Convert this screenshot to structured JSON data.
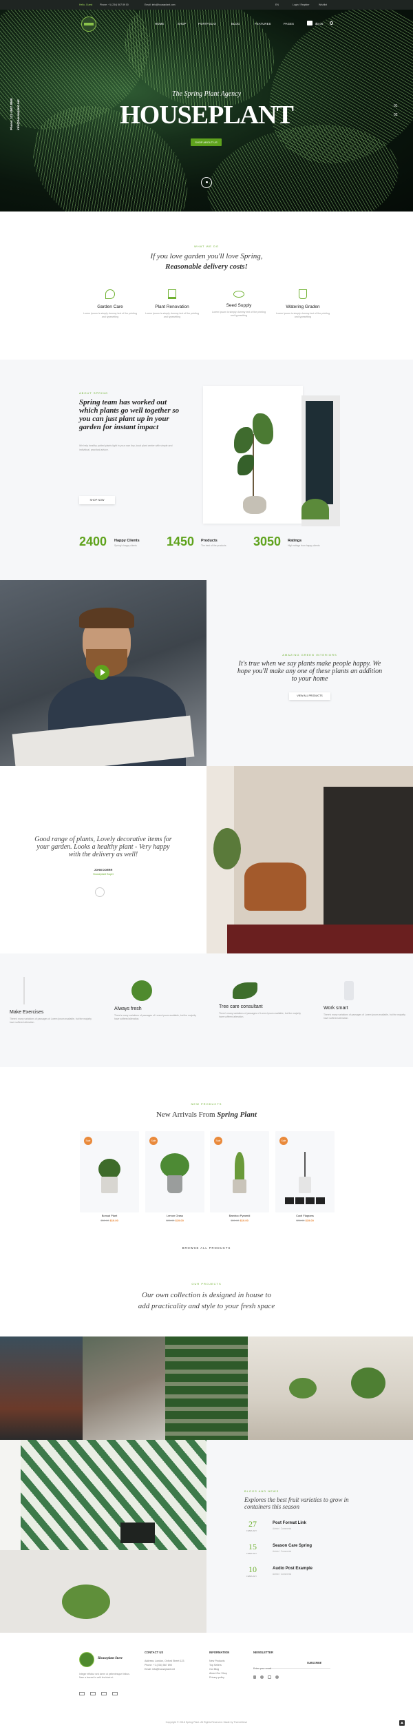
{
  "topbar": {
    "left": "Hello, Guest",
    "phone": "Phone: +1 (234) 567 89 00",
    "email": "Email: info@houseplant.com",
    "lang": "EN",
    "account": "Login / Register",
    "wishlist": "Wishlist"
  },
  "nav": {
    "items": [
      "HOME",
      "SHOP",
      "PORTFOLIO",
      "BLOG",
      "FEATURES",
      "PAGES"
    ],
    "cart": "$0.00"
  },
  "hero": {
    "subtitle": "The Spring Plant Agency",
    "title": "HOUSEPLANT",
    "button": "SHOP ABOUT US",
    "side_phone": "Phone: 123 4567 8900",
    "side_email": "info@houseplant.net",
    "slides": [
      "01",
      "02"
    ]
  },
  "intro": {
    "label": "WHAT WE DO",
    "line1": "If you love garden you'll love Spring,",
    "line2": "Reasonable delivery costs!",
    "features": [
      {
        "title": "Garden Care",
        "text": "Lorem Ipsum is simply dummy text of the printing and typesetting"
      },
      {
        "title": "Plant Renovation",
        "text": "Lorem Ipsum is simply dummy text of the printing and typesetting"
      },
      {
        "title": "Seed Supply",
        "text": "Lorem Ipsum is simply dummy text of the printing and typesetting"
      },
      {
        "title": "Watering Graden",
        "text": "Lorem Ipsum is simply dummy text of the printing and typesetting"
      }
    ]
  },
  "about": {
    "label": "ABOUT SPRING",
    "headline": "Spring team has worked out which plants go well together so you can just plant up in your garden for instant impact",
    "body": "We help healthy potted plants light in your own tiny, local plant center with simple and individual, practical advice.",
    "button": "SHOP NOW",
    "stats": [
      {
        "num": "2400",
        "label": "Happy Clients",
        "sub": "Spring's happy clients"
      },
      {
        "num": "1450",
        "label": "Products",
        "sub": "The best of the products"
      },
      {
        "num": "3050",
        "label": "Ratings",
        "sub": "High ratings from happy clients"
      }
    ]
  },
  "promo": {
    "label": "AMAZING GREEN INTERIORS",
    "text": "It's true when we say plants make people happy. We hope you'll make any one of these plants an addition to your home",
    "button": "VIEW ALL PRODUCTS"
  },
  "quote": {
    "text": "Good range of plants, Lovely decorative items for your garden. Looks a healthy plant - Very happy with the delivery as well!",
    "author": "JOHN DOERR",
    "role": "Houseplant Buyer"
  },
  "services": [
    {
      "title": "Make Exercises",
      "text": "There's many variations of passages of Lorem Ipsum available, but the majority have suffered alteration."
    },
    {
      "title": "Always fresh",
      "text": "There's many variations of passages of Lorem Ipsum available, but the majority have suffered alteration."
    },
    {
      "title": "Tree care consultant",
      "text": "There's many variations of passages of Lorem Ipsum available, but the majority have suffered alteration."
    },
    {
      "title": "Work smart",
      "text": "There's many variations of passages of Lorem Ipsum available, but the majority have suffered alteration."
    }
  ],
  "products": {
    "label": "NEW PRODUCTS",
    "title": "New Arrivals From",
    "title_em": "Spring Plant",
    "browse": "BROWSE ALL PRODUCTS",
    "items": [
      {
        "name": "Bonsai Plant",
        "old": "$30.00",
        "price": "$19.00",
        "badge": "Sale"
      },
      {
        "name": "Lemon Grass",
        "old": "$30.00",
        "price": "$19.00",
        "badge": "Sale"
      },
      {
        "name": "Bamboo Pyramid",
        "old": "$30.00",
        "price": "$19.00",
        "badge": "Sale"
      },
      {
        "name": "Cacti Flagrans",
        "old": "$30.00",
        "price": "$19.00",
        "badge": "Sale"
      }
    ]
  },
  "collection": {
    "label": "OUR PROJECTS",
    "text": "Our own collection is designed in house to add practicality and style to your fresh space"
  },
  "blog": {
    "label": "BLOGS AND NEWS",
    "headline": "Explores the best fruit varieties to grow in containers this season",
    "posts": [
      {
        "day": "27",
        "month": "FEBRUARY",
        "title": "Post Format Link",
        "meta": "Admin / Comments"
      },
      {
        "day": "15",
        "month": "FEBRUARY",
        "title": "Season Care Spring",
        "meta": "Admin / Comments"
      },
      {
        "day": "10",
        "month": "FEBRUARY",
        "title": "Audio Post Example",
        "meta": "Admin / Comments"
      }
    ]
  },
  "footer": {
    "brand": "Houseplant Store",
    "about": "Integer efficitur sed lorem ut pellentesque finibus. Nam a laoreet in velit tincidunt et.",
    "contact_head": "CONTACT US",
    "contact": [
      "Address: London, Oxford Street 123",
      "Phone: +1 (234) 567 890",
      "Email: info@houseplant.net"
    ],
    "info_head": "INFORMATION",
    "info": [
      "New Products",
      "Top Sellers",
      "Our Blog",
      "About Our Shop",
      "Privacy policy"
    ],
    "news_head": "NEWSLETTER",
    "news_placeholder": "Enter your email",
    "subscribe": "SUBSCRIBE",
    "copyright": "Copyright © 2018 Spring Plant. All Rights Reserved. Made by ThemeMove"
  },
  "colors": {
    "accent": "#5fa31d",
    "orange": "#e9893a",
    "dark": "#1f2522"
  }
}
